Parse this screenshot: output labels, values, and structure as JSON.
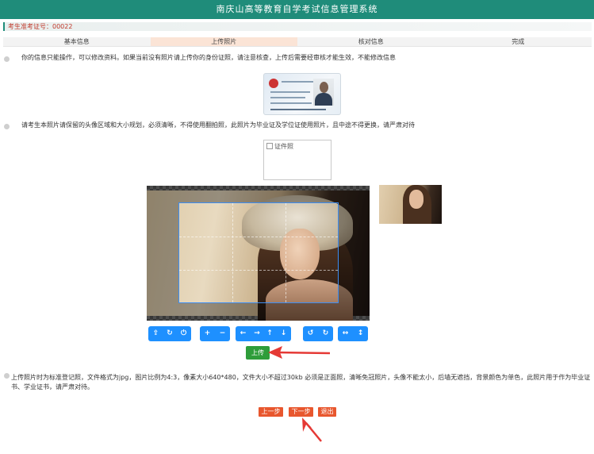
{
  "app": {
    "title": "南庆山高等教育自学考试信息管理系统"
  },
  "user": {
    "label": "考生准考证号：00022"
  },
  "tabs": [
    {
      "label": "基本信息",
      "active": false
    },
    {
      "label": "上传照片",
      "active": true
    },
    {
      "label": "核对信息",
      "active": false
    },
    {
      "label": "完成",
      "active": false
    }
  ],
  "notes": {
    "first": "你的信息只能操作，可以修改资料。如果当前没有照片请上传你的身份证照，请注意核查，上传后需要经审核才能生效，不能修改信息",
    "second": "请考生本照片请保留的头像区域和大小规划，必须清晰，不得使用翻拍照，此照片为毕业证及学位证使用照片，且中途不得更换，请严肃对待"
  },
  "placeholder": {
    "alt": "证件照"
  },
  "toolbar": {
    "groups": [
      [
        "upload-icon",
        "refresh-icon",
        "power-icon"
      ],
      [
        "zoom-in-icon",
        "zoom-out-icon"
      ],
      [
        "arrow-left-icon",
        "arrow-right-icon",
        "arrow-up-icon",
        "arrow-down-icon"
      ],
      [
        "rotate-left-icon",
        "rotate-right-icon"
      ],
      [
        "flip-horizontal-icon",
        "flip-vertical-icon"
      ]
    ]
  },
  "upload": {
    "label": "上传"
  },
  "rules": {
    "text": "上传照片时为标准登记照，文件格式为jpg，图片比例为4:3，像素大小640*480，文件大小不超过30kb 必须是正面照，清晰免冠照片，头像不能太小，后墙无遮挡，背景颜色为单色，此照片用于作为毕业证书、学业证书，请严肃对待。"
  },
  "nav": {
    "prev": "上一步",
    "next": "下一步",
    "exit": "退出"
  },
  "colors": {
    "header": "#1f8c7a",
    "accent_blue": "#1e90ff",
    "upload_green": "#2e9d3a",
    "nav_orange": "#e8572e",
    "annotation_red": "#e53935"
  }
}
